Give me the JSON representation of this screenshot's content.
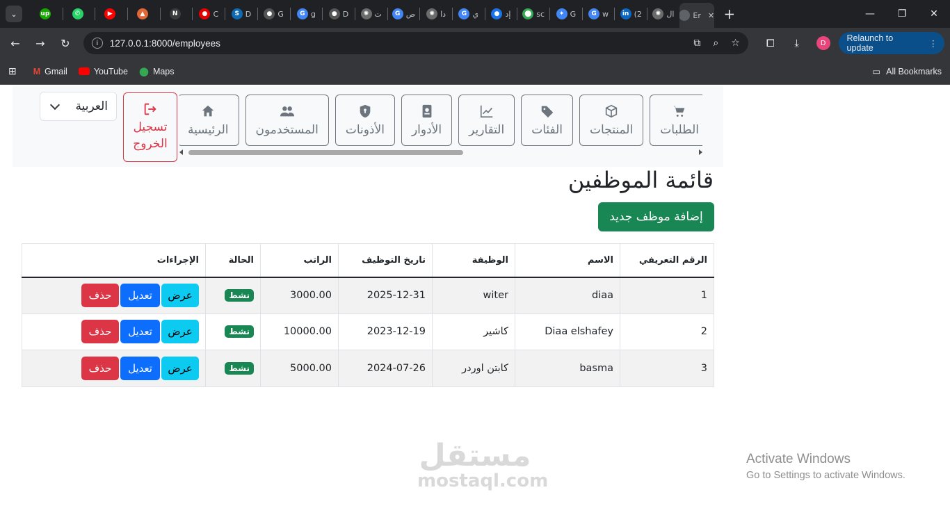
{
  "browser": {
    "tabs": [
      {
        "label": "",
        "icon": "upwork-icon",
        "color": "#14a800",
        "glyph": "up"
      },
      {
        "label": "",
        "icon": "whatsapp-icon",
        "color": "#25d366",
        "glyph": "✆"
      },
      {
        "label": "",
        "icon": "youtube-icon",
        "color": "#ff0000",
        "glyph": "▶"
      },
      {
        "label": "",
        "icon": "matlab-icon",
        "color": "#e16737",
        "glyph": "▲"
      },
      {
        "label": "",
        "icon": "notion-icon",
        "color": "#3b3b3b",
        "glyph": "N"
      },
      {
        "label": "C",
        "icon": "vodafone-icon",
        "color": "#e60000",
        "glyph": "●"
      },
      {
        "label": "D",
        "icon": "s-app-icon",
        "color": "#0f6ab4",
        "glyph": "S"
      },
      {
        "label": "G",
        "icon": "github-icon",
        "color": "#555555",
        "glyph": "●"
      },
      {
        "label": "g",
        "icon": "google-icon",
        "color": "#4285f4",
        "glyph": "G"
      },
      {
        "label": "D",
        "icon": "github-icon",
        "color": "#555555",
        "glyph": "●"
      },
      {
        "label": "ت",
        "icon": "chatgpt-icon",
        "color": "#6b6b6b",
        "glyph": "✺"
      },
      {
        "label": "ص",
        "icon": "google-icon",
        "color": "#4285f4",
        "glyph": "G"
      },
      {
        "label": "دا",
        "icon": "chatgpt-icon",
        "color": "#6b6b6b",
        "glyph": "✺"
      },
      {
        "label": "ي",
        "icon": "google-icon",
        "color": "#4285f4",
        "glyph": "G"
      },
      {
        "label": "إد",
        "icon": "circle-app-icon",
        "color": "#1a73e8",
        "glyph": "●"
      },
      {
        "label": "sc",
        "icon": "maps-icon",
        "color": "#34a853",
        "glyph": "⬤"
      },
      {
        "label": "G",
        "icon": "gemini-icon",
        "color": "#4285f4",
        "glyph": "✦"
      },
      {
        "label": "w",
        "icon": "google-icon",
        "color": "#4285f4",
        "glyph": "G"
      },
      {
        "label": "(2",
        "icon": "linkedin-icon",
        "color": "#0a66c2",
        "glyph": "in"
      },
      {
        "label": "ال",
        "icon": "chatgpt-icon",
        "color": "#6b6b6b",
        "glyph": "✺"
      },
      {
        "label": "Er",
        "icon": "page-icon",
        "color": "#5f6368",
        "glyph": "",
        "active": true
      }
    ],
    "url": "127.0.0.1:8000/employees",
    "relaunch_label": "Relaunch to update",
    "profile_initial": "D",
    "bookmarks": [
      {
        "label": "Gmail",
        "icon": "gmail-icon"
      },
      {
        "label": "YouTube",
        "icon": "youtube-icon"
      },
      {
        "label": "Maps",
        "icon": "maps-icon"
      }
    ],
    "all_bookmarks": "All Bookmarks"
  },
  "nav": {
    "items": [
      {
        "label": "الطلبات",
        "icon": "cart-icon"
      },
      {
        "label": "المنتجات",
        "icon": "box-icon"
      },
      {
        "label": "الفئات",
        "icon": "tag-icon"
      },
      {
        "label": "التقارير",
        "icon": "chart-icon"
      },
      {
        "label": "الأدوار",
        "icon": "id-badge-icon"
      },
      {
        "label": "الأذونات",
        "icon": "shield-icon"
      },
      {
        "label": "المستخدمون",
        "icon": "users-icon"
      },
      {
        "label": "الرئيسية",
        "icon": "home-icon"
      }
    ],
    "logout_line1": "تسجيل",
    "logout_line2": "الخروج",
    "language": "العربية"
  },
  "page": {
    "title": "قائمة الموظفين",
    "add_button": "إضافة موظف جديد"
  },
  "table": {
    "headers": {
      "id": "الرقم التعريفي",
      "name": "الاسم",
      "job": "الوظيفة",
      "hire_date": "تاريخ التوظيف",
      "salary": "الراتب",
      "status": "الحالة",
      "actions": "الإجراءات"
    },
    "rows": [
      {
        "id": "1",
        "name": "diaa",
        "job": "witer",
        "hire_date": "2025-12-31",
        "salary": "3000.00",
        "status": "نشط"
      },
      {
        "id": "2",
        "name": "Diaa elshafey",
        "job": "كاشير",
        "hire_date": "2023-12-19",
        "salary": "10000.00",
        "status": "نشط"
      },
      {
        "id": "3",
        "name": "basma",
        "job": "كابتن اوردر",
        "hire_date": "2024-07-26",
        "salary": "5000.00",
        "status": "نشط"
      }
    ],
    "view_label": "عرض",
    "edit_label": "تعديل",
    "delete_label": "حذف"
  },
  "watermark": {
    "ar": "مستقل",
    "en": "mostaql.com"
  },
  "activation": {
    "line1": "Activate Windows",
    "line2": "Go to Settings to activate Windows."
  },
  "colors": {
    "primary": "#0d6efd",
    "success": "#198754",
    "danger": "#dc3545",
    "info": "#0dcaf0"
  }
}
